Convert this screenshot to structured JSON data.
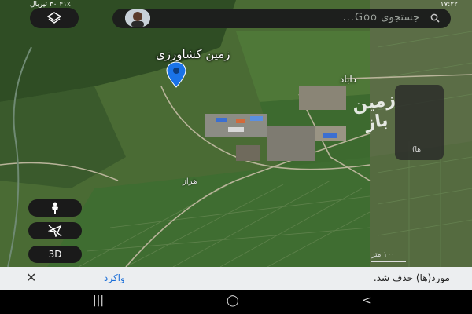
{
  "status_bar": {
    "left_text": "۴۱٪ ۳۰ تیربال",
    "clock": "۱۷:۲۲"
  },
  "search": {
    "placeholder": "جستجوی Goo..."
  },
  "map": {
    "pin_label": "زمین کشاورزی",
    "town_label": "داباد",
    "road_label": "هراز",
    "watermark": "زمین باز",
    "panel_small": "(ها",
    "scale_label": "۱۰۰ متر"
  },
  "controls": {
    "three_d_label": "3D"
  },
  "snackbar": {
    "message": "مورد(ها) حذف شد.",
    "undo_label": "واکرد",
    "close_icon": "✕"
  },
  "navbar": {
    "recents": "|||",
    "home": "◯",
    "back": "<"
  },
  "colors": {
    "pin": "#1a73e8",
    "undo": "#1a6ed8",
    "map_base": "#4c6e35"
  }
}
